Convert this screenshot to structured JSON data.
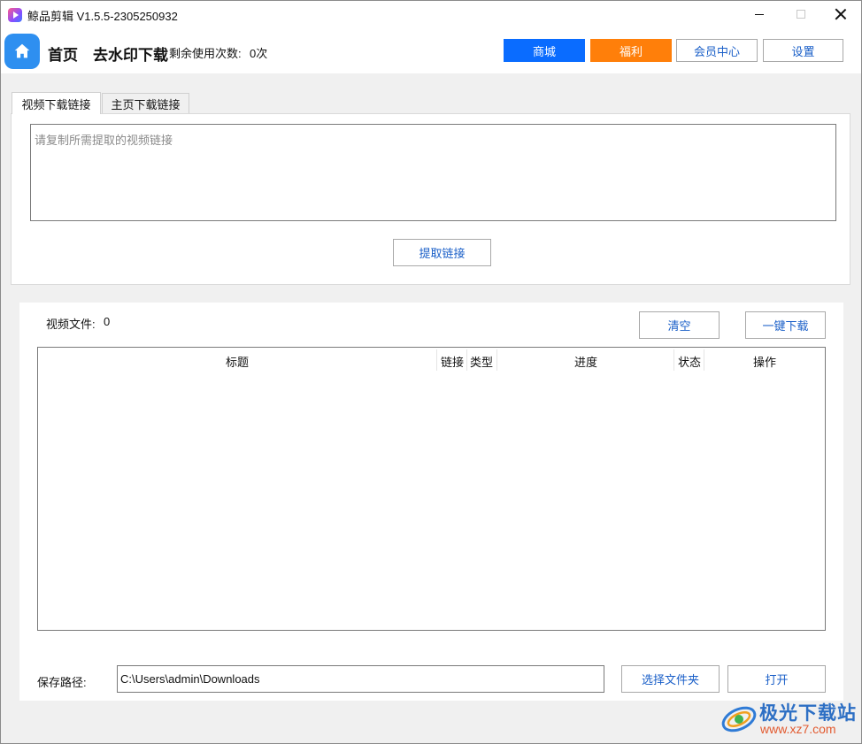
{
  "window": {
    "title": "鲸品剪辑 V1.5.5-2305250932"
  },
  "header": {
    "home_label": "首页",
    "section_title": "去水印下载",
    "remaining_label": "剩余使用次数:",
    "remaining_count": "0次",
    "buttons": {
      "shop": "商城",
      "welfare": "福利",
      "member": "会员中心",
      "settings": "设置"
    },
    "colors": {
      "shop": "#0a6cff",
      "welfare": "#ff7f0a",
      "home_icon": "#2e8ff0"
    }
  },
  "tabs": [
    {
      "label": "视频下载链接",
      "active": true
    },
    {
      "label": "主页下载链接",
      "active": false
    }
  ],
  "link_input": {
    "placeholder": "请复制所需提取的视频链接",
    "value": ""
  },
  "extract_button": "提取链接",
  "files": {
    "count_label": "视频文件:",
    "count": "0",
    "clear_button": "清空",
    "download_all_button": "一键下载"
  },
  "table": {
    "columns": [
      "标题",
      "链接",
      "类型",
      "进度",
      "状态",
      "操作"
    ],
    "rows": []
  },
  "save_path": {
    "label": "保存路径:",
    "value": "C:\\Users\\admin\\Downloads",
    "choose_button": "选择文件夹",
    "open_button": "打开"
  },
  "watermark": {
    "brand": "极光下载站",
    "url": "www.xz7.com"
  }
}
